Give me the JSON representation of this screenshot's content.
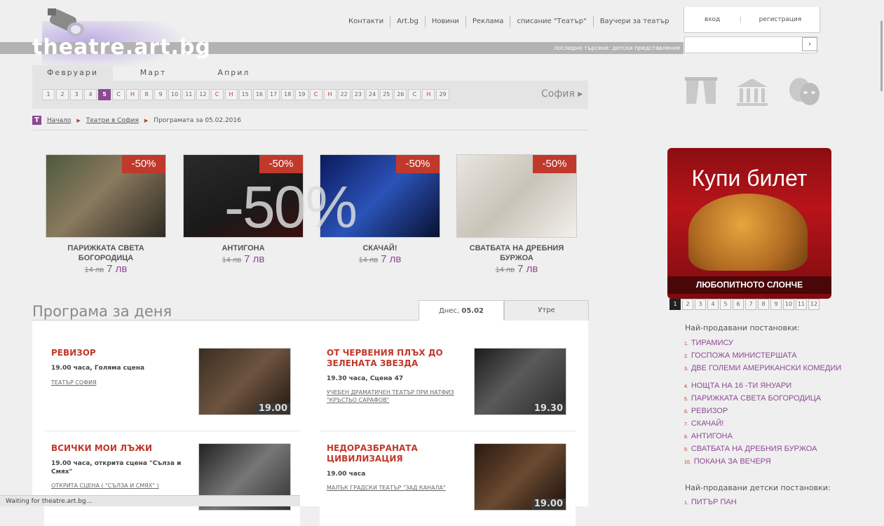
{
  "header": {
    "logo": "theatre.art.bg",
    "nav": [
      "Контакти",
      "Art.bg",
      "Новини",
      "Реклама",
      "списание \"Театър\"",
      "Ваучери за театър"
    ],
    "login": "вход",
    "register": "регистрация",
    "last_searched": "последно търсене: детски представления",
    "search_button": "›"
  },
  "calendar": {
    "months": [
      "Февруари",
      "Март",
      "Април"
    ],
    "days": [
      {
        "l": "1"
      },
      {
        "l": "2"
      },
      {
        "l": "3"
      },
      {
        "l": "4"
      },
      {
        "l": "5",
        "sel": true
      },
      {
        "l": "С",
        "we": true
      },
      {
        "l": "Н",
        "we": true
      },
      {
        "l": "8"
      },
      {
        "l": "9"
      },
      {
        "l": "10"
      },
      {
        "l": "11"
      },
      {
        "l": "12"
      },
      {
        "l": "С",
        "we": true
      },
      {
        "l": "Н",
        "we": true
      },
      {
        "l": "15"
      },
      {
        "l": "16"
      },
      {
        "l": "17"
      },
      {
        "l": "18"
      },
      {
        "l": "19"
      },
      {
        "l": "С",
        "we": true
      },
      {
        "l": "Н",
        "we": true
      },
      {
        "l": "22"
      },
      {
        "l": "23"
      },
      {
        "l": "24"
      },
      {
        "l": "25"
      },
      {
        "l": "26"
      },
      {
        "l": "С",
        "we": true
      },
      {
        "l": "Н",
        "we": true
      },
      {
        "l": "29"
      }
    ],
    "city": "София ▸"
  },
  "breadcrumb": {
    "home": "Начало",
    "theatres": "Театри в София",
    "current": "Програмата за 05.02.2016"
  },
  "promos": [
    {
      "title": "ПАРИЖКАТА СВЕТА БОГОРОДИЦА",
      "old": "14 лв",
      "new": "7 лв",
      "badge": "-50%"
    },
    {
      "title": "АНТИГОНА",
      "old": "14 лв",
      "new": "7 лв",
      "badge": "-50%"
    },
    {
      "title": "СКАЧАЙ!",
      "old": "14 лв",
      "new": "7 лв",
      "badge": "-50%"
    },
    {
      "title": "СВАТБАТА НА ДРЕБНИЯ БУРЖОА",
      "old": "14 лв",
      "new": "7 лв",
      "badge": "-50%"
    }
  ],
  "big_discount": "-50%",
  "program": {
    "title": "Програма за деня",
    "tab_today_label": "Днес,",
    "tab_today_date": "05.02",
    "tab_tomorrow": "Утре",
    "items": [
      {
        "title": "РЕВИЗОР",
        "time": "19.00 часа, Голяма сцена",
        "venue": "ТЕАТЪР СОФИЯ",
        "tag": "19.00"
      },
      {
        "title": "ОТ ЧЕРВЕНИЯ ПЛЪХ ДО ЗЕЛЕНАТА ЗВЕЗДА",
        "time": "19.30 часа, Сцена 47",
        "venue": "УЧЕБЕН ДРАМАТИЧЕН ТЕАТЪР ПРИ НАТФИЗ \"КРЪСТЬО САРАФОВ\"",
        "tag": "19.30"
      },
      {
        "title": "ВСИЧКИ МОИ ЛЪЖИ",
        "time": "19.00 часа, открита сцена \"Сълза и Смях\"",
        "venue": "ОТКРИТА СЦЕНА ( \"СЪЛЗА И СМЯХ\" )",
        "tag": ""
      },
      {
        "title": "НЕДОРАЗБРАНАТА ЦИВИЛИЗАЦИЯ",
        "time": "19.00 часа",
        "venue": "МАЛЪК ГРАДСКИ ТЕАТЪР \"ЗАД КАНАЛА\"",
        "tag": "19.00"
      }
    ]
  },
  "banner": {
    "headline": "Купи билет",
    "caption": "ЛЮБОПИТНОТО СЛОНЧЕ",
    "pages": [
      "1",
      "2",
      "3",
      "4",
      "5",
      "6",
      "7",
      "8",
      "9",
      "10",
      "11",
      "12"
    ]
  },
  "bestsellers": {
    "title": "Най-продавани постановки:",
    "items": [
      "ТИРАМИСУ",
      "ГОСПОЖА МИНИСТЕРШАТА",
      "ДВЕ ГОЛЕМИ АМЕРИКАНСКИ КОМЕДИИ",
      "НОЩТА НА 16 -ТИ ЯНУАРИ",
      "ПАРИЖКАТА СВЕТА БОГОРОДИЦА",
      "РЕВИЗОР",
      "СКАЧАЙ!",
      "АНТИГОНА",
      "СВАТБАТА НА ДРЕБНИЯ БУРЖОА",
      "ПОКАНА ЗА ВЕЧЕРЯ"
    ]
  },
  "kids": {
    "title": "Най-продавани детски постановки:",
    "items": [
      "ПИТЪР ПАН"
    ]
  },
  "status": "Waiting for theatre.art.bg...",
  "colors": {
    "accent": "#8c4a93",
    "red": "#c0392b",
    "grey_bar": "#b3b3b3"
  }
}
